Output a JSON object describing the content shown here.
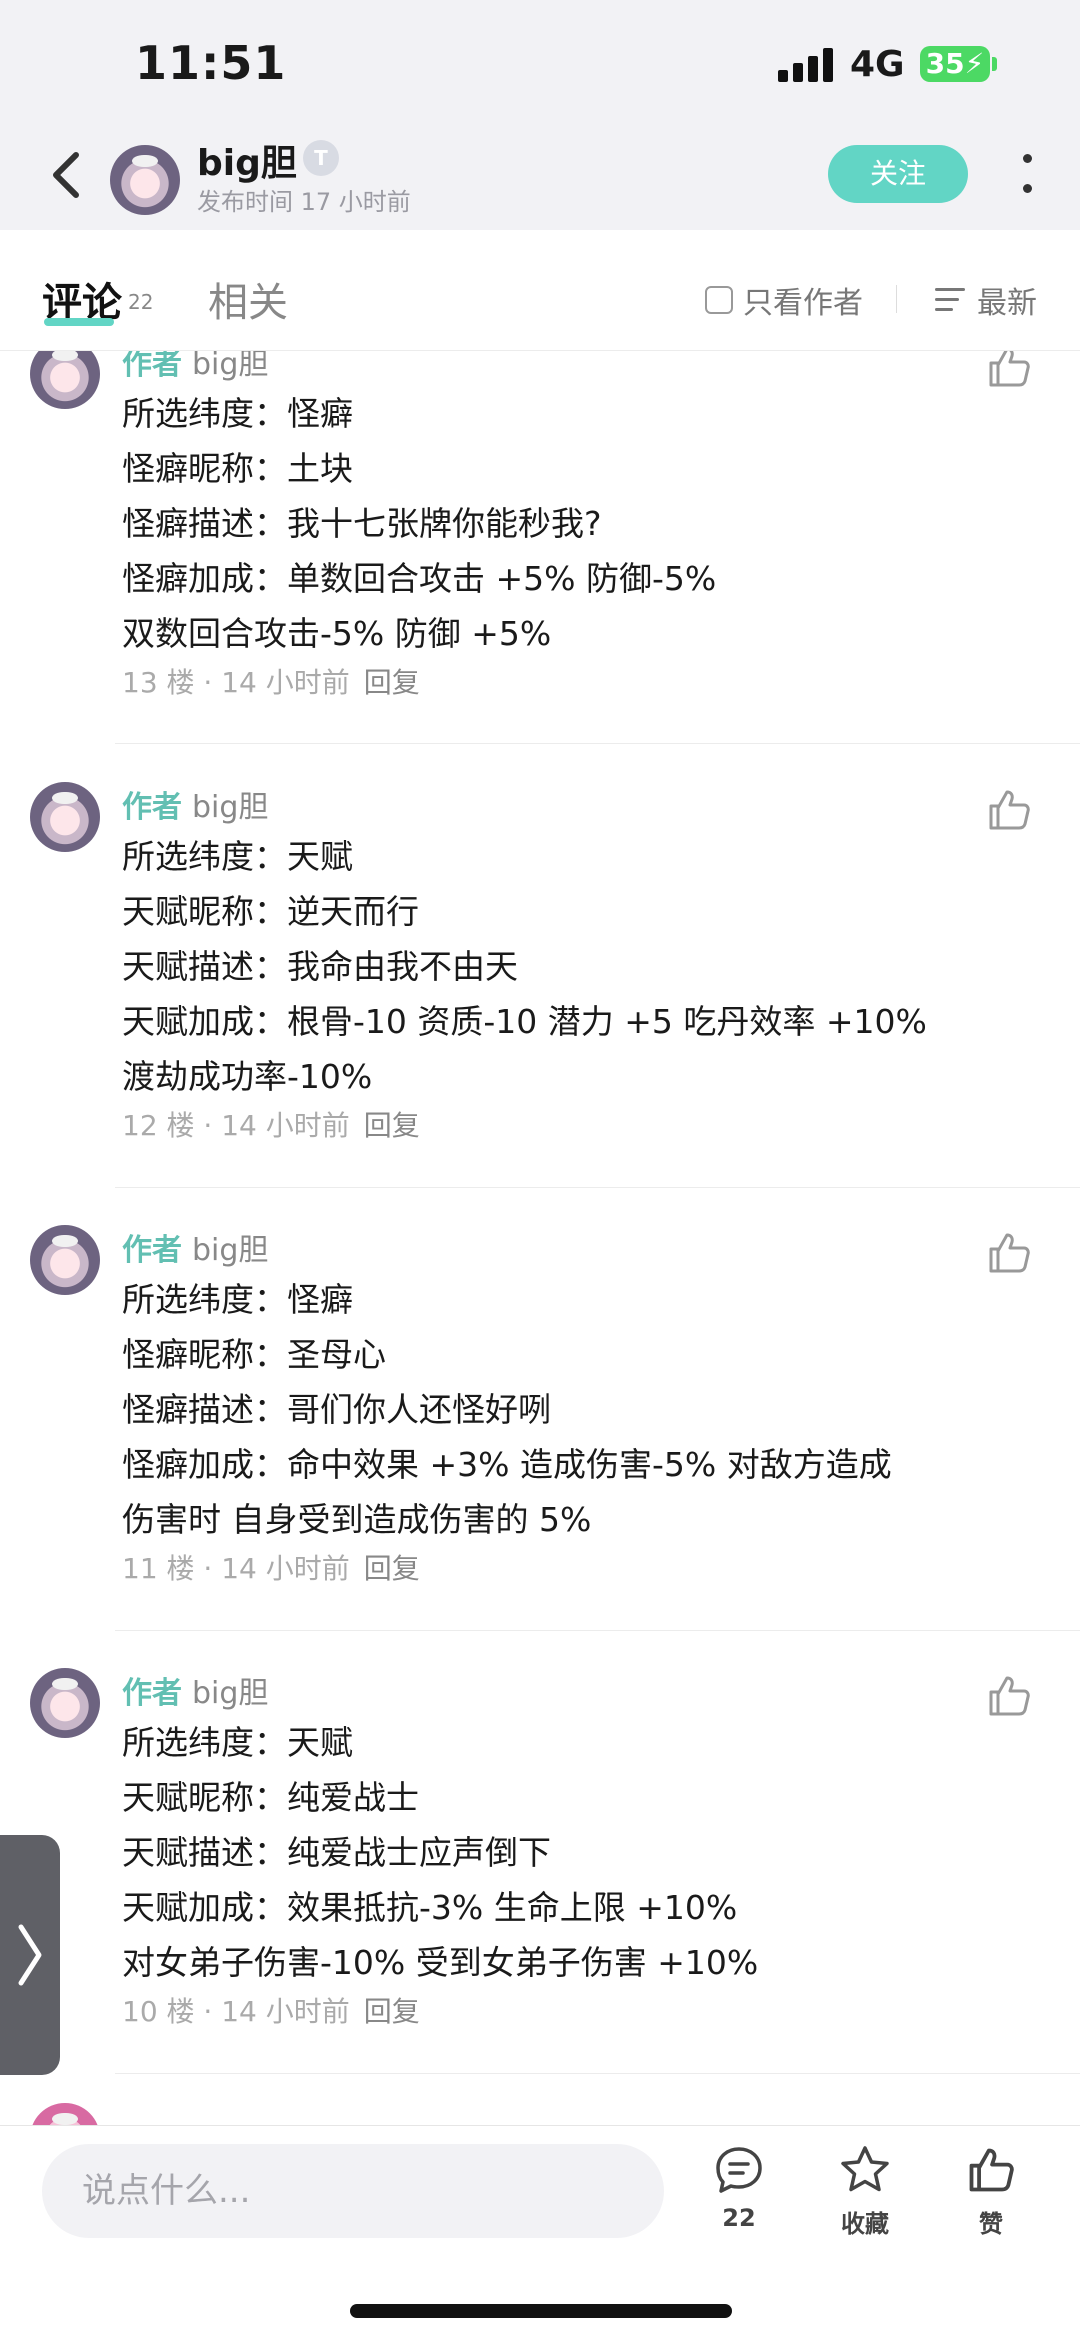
{
  "status_bar": {
    "time": "11:51",
    "network": "4G",
    "battery": "35"
  },
  "header": {
    "author_name": "big胆",
    "badge": "T",
    "publish_time": "发布时间 17 小时前",
    "follow_label": "关注"
  },
  "tabs": {
    "comments_label": "评论",
    "comments_count": "22",
    "related_label": "相关",
    "only_author_label": "只看作者",
    "sort_label": "最新"
  },
  "comments": [
    {
      "author_tag": "作者",
      "user": "big胆",
      "lines": [
        "所选纬度：怪癖",
        "怪癖昵称：土块",
        "怪癖描述：我十七张牌你能秒我?",
        "怪癖加成：单数回合攻击 +5% 防御-5%",
        "双数回合攻击-5% 防御 +5%"
      ],
      "footer": "13 楼 · 14 小时前",
      "reply": "回复"
    },
    {
      "author_tag": "作者",
      "user": "big胆",
      "lines": [
        "所选纬度：天赋",
        "天赋昵称：逆天而行",
        "天赋描述：我命由我不由天",
        "天赋加成：根骨-10 资质-10 潜力 +5 吃丹效率 +10%",
        "渡劫成功率-10%"
      ],
      "footer": "12 楼 · 14 小时前",
      "reply": "回复"
    },
    {
      "author_tag": "作者",
      "user": "big胆",
      "lines": [
        "所选纬度：怪癖",
        "怪癖昵称：圣母心",
        "怪癖描述：哥们你人还怪好咧",
        "怪癖加成：命中效果 +3% 造成伤害-5%  对敌方造成",
        "伤害时 自身受到造成伤害的 5%"
      ],
      "footer": "11 楼 · 14 小时前",
      "reply": "回复"
    },
    {
      "author_tag": "作者",
      "user": "big胆",
      "lines": [
        "所选纬度：天赋",
        "天赋昵称：纯爱战士",
        "天赋描述：纯爱战士应声倒下",
        "天赋加成：效果抵抗-3% 生命上限 +10%",
        "对女弟子伤害-10% 受到女弟子伤害 +10%"
      ],
      "footer": "10 楼 · 14 小时前",
      "reply": "回复"
    }
  ],
  "bottom_bar": {
    "input_placeholder": "说点什么...",
    "comment_count": "22",
    "favorite_label": "收藏",
    "like_label": "赞"
  },
  "colors": {
    "accent": "#62d5c5",
    "author_tag": "#62bfb2"
  }
}
